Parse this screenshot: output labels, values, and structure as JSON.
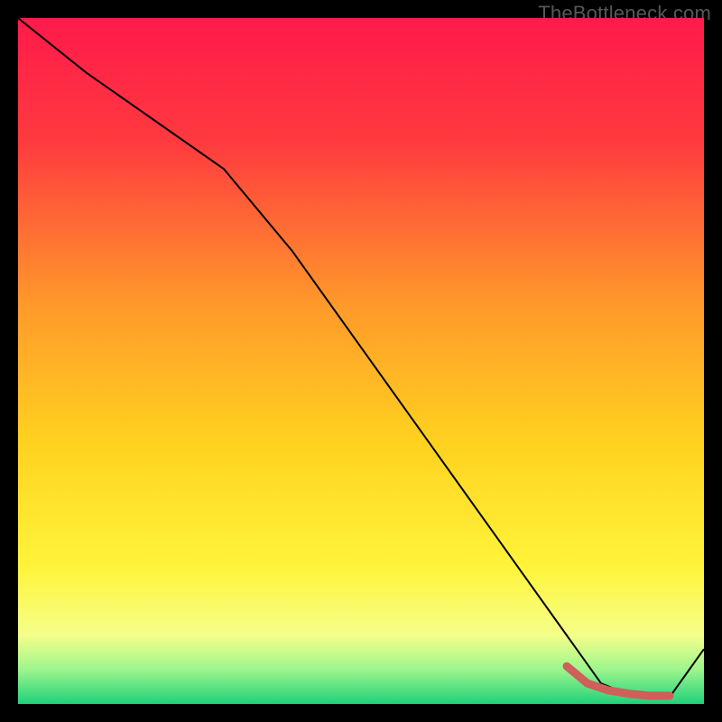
{
  "watermark": "TheBottleneck.com",
  "colors": {
    "curve": "#000000",
    "highlight": "#cf5f5a"
  },
  "chart_data": {
    "type": "line",
    "title": "",
    "xlabel": "",
    "ylabel": "",
    "xlim": [
      0,
      100
    ],
    "ylim": [
      0,
      100
    ],
    "grid": false,
    "series": [
      {
        "name": "bottleneck-curve",
        "x": [
          0,
          10,
          20,
          30,
          40,
          50,
          60,
          70,
          80,
          85,
          90,
          95,
          100
        ],
        "y": [
          100,
          92,
          85,
          78,
          66,
          52,
          38,
          24,
          10,
          3,
          1,
          1,
          8
        ]
      }
    ],
    "highlight": {
      "name": "optimal-range",
      "x": [
        80,
        83,
        86,
        89,
        92,
        95
      ],
      "y": [
        5.5,
        3.0,
        2.0,
        1.5,
        1.2,
        1.2
      ]
    }
  }
}
